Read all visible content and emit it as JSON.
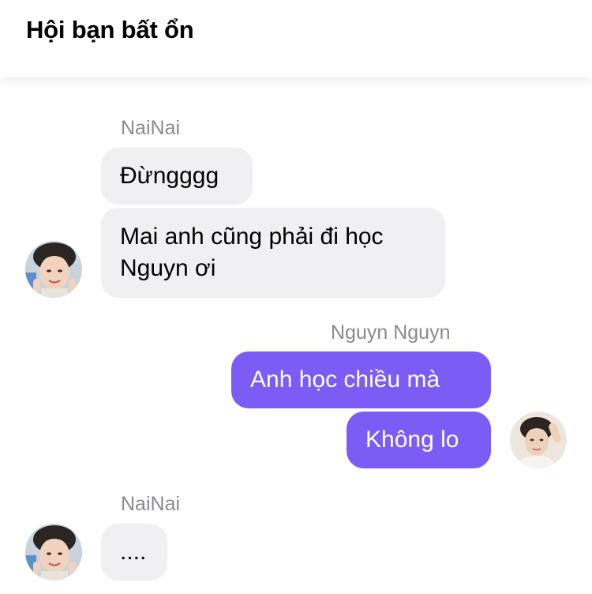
{
  "header": {
    "title": "Hội bạn bất ổn"
  },
  "messages": {
    "group1": {
      "sender": "NaiNai",
      "bubble1": "Đừngggg",
      "bubble2_line1": "Mai anh cũng phải đi học",
      "bubble2_line2": "Nguyn ơi"
    },
    "group2": {
      "sender": "Nguyn Nguyn",
      "bubble1": "Anh học chiều mà",
      "bubble2": "Không lo"
    },
    "group3": {
      "sender": "NaiNai",
      "bubble1": "...."
    }
  },
  "colors": {
    "incoming_bubble": "#f0f0f2",
    "outgoing_bubble": "#7b5cf5",
    "sender_name": "#8a8a8e"
  },
  "icons": {
    "nainai_avatar": "avatar-photo",
    "nguyn_avatar": "avatar-photo"
  }
}
